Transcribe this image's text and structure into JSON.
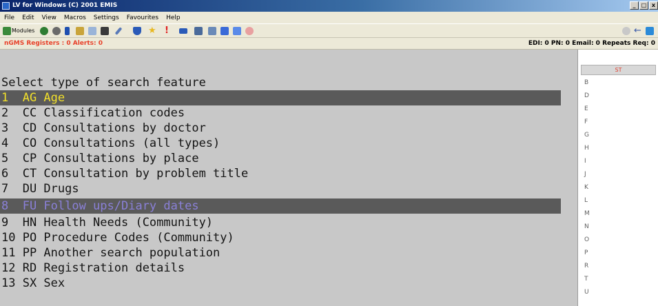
{
  "window": {
    "title": "LV for Windows (C) 2001 EMIS"
  },
  "menu": [
    "File",
    "Edit",
    "View",
    "Macros",
    "Settings",
    "Favourites",
    "Help"
  ],
  "toolbar": {
    "modules_label": "Modules"
  },
  "status": {
    "left": "nGMS Registers : 0  Alerts: 0",
    "right": "EDI: 0  PN: 0  Email: 0  Repeats Req: 0"
  },
  "terminal": {
    "header": "Select type of search feature",
    "options": [
      {
        "text": "1  AG Age",
        "highlight": "yellow"
      },
      {
        "text": "2  CC Classification codes",
        "highlight": ""
      },
      {
        "text": "3  CD Consultations by doctor",
        "highlight": ""
      },
      {
        "text": "4  CO Consultations (all types)",
        "highlight": ""
      },
      {
        "text": "5  CP Consultations by place",
        "highlight": ""
      },
      {
        "text": "6  CT Consultation by problem title",
        "highlight": ""
      },
      {
        "text": "7  DU Drugs",
        "highlight": ""
      },
      {
        "text": "8  FU Follow ups/Diary dates",
        "highlight": "purple"
      },
      {
        "text": "9  HN Health Needs (Community)",
        "highlight": ""
      },
      {
        "text": "10 PO Procedure Codes (Community)",
        "highlight": ""
      },
      {
        "text": "11 PP Another search population",
        "highlight": ""
      },
      {
        "text": "12 RD Registration details",
        "highlight": ""
      },
      {
        "text": "13 SX Sex",
        "highlight": ""
      }
    ]
  },
  "side": {
    "header": "ST",
    "letters": [
      "B",
      "D",
      "E",
      "F",
      "G",
      "H",
      "I",
      "J",
      "K",
      "L",
      "M",
      "N",
      "O",
      "P",
      "R",
      "T",
      "U"
    ]
  },
  "colors": {
    "highlight_bg": "#5a5a5a",
    "highlight_yellow": "#f2e02a",
    "highlight_purple": "#8a80d8",
    "alert_red": "#e8412a"
  },
  "icons": [
    "app-icon",
    "modules-icon",
    "people-icon",
    "tools-icon",
    "cut-icon",
    "paste-icon",
    "save-icon",
    "flask-icon",
    "star-icon",
    "exclamation-icon",
    "card-icon",
    "back-arrow-icon",
    "globe-icon"
  ]
}
